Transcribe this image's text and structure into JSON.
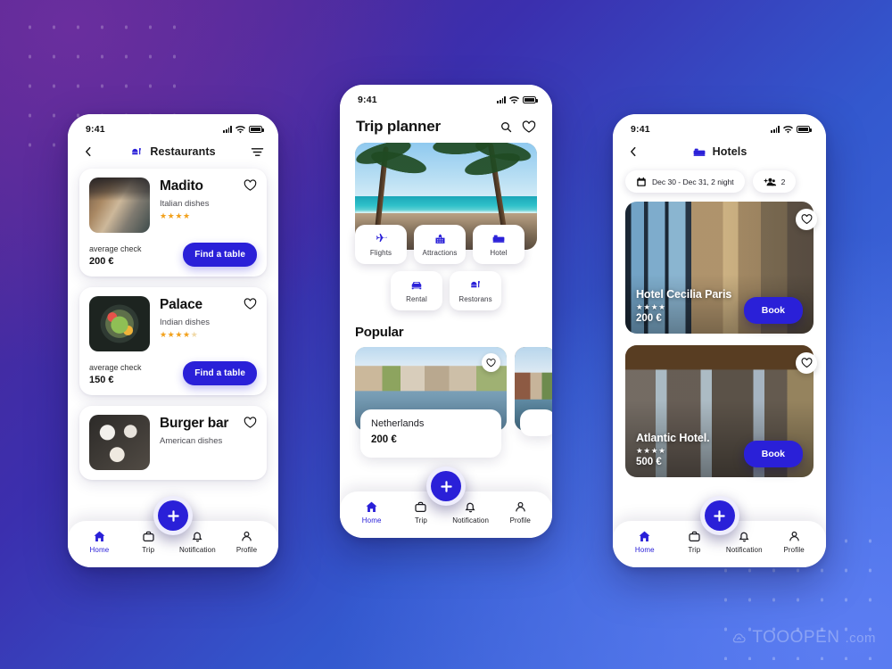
{
  "background": {
    "gradient_from": "#53268E",
    "gradient_mid": "#3358CE",
    "gradient_to": "#4571E4",
    "accent": "#2A20D8",
    "star_color": "#F2A11C"
  },
  "watermark": {
    "brand": "TOOOPEN",
    "suffix": ".com",
    "icon": "cloud-icon"
  },
  "phones": {
    "restaurants": {
      "status": {
        "time": "9:41",
        "signal_icon": "signal-bars-icon",
        "wifi_icon": "wifi-icon",
        "battery_icon": "battery-icon"
      },
      "header": {
        "back_icon": "chevron-left-icon",
        "title_icon": "restaurant-icon",
        "title": "Restaurants",
        "filter_icon": "filter-icon"
      },
      "cards": [
        {
          "name": "Madito",
          "cuisine": "Italian dishes",
          "rating": 4,
          "rating_max": 4,
          "avg_label": "average check",
          "price": "200  €",
          "cta": "Find a table",
          "heart_icon": "heart-outline-icon",
          "thumb": "restaurant-interior-photo"
        },
        {
          "name": "Palace",
          "cuisine": "Indian dishes",
          "rating": 4,
          "rating_max": 5,
          "avg_label": "average check",
          "price": "150  €",
          "cta": "Find a table",
          "heart_icon": "heart-outline-icon",
          "thumb": "salad-bowl-photo"
        },
        {
          "name": "Burger bar",
          "cuisine": "American dishes",
          "rating": 0,
          "rating_max": 0,
          "avg_label": "",
          "price": "",
          "cta": "",
          "heart_icon": "heart-outline-icon",
          "thumb": "burger-table-photo"
        }
      ],
      "fab": {
        "icon": "plus-icon"
      },
      "nav": [
        {
          "label": "Home",
          "icon": "home-icon",
          "active": true
        },
        {
          "label": "Trip",
          "icon": "briefcase-icon",
          "active": false
        },
        {
          "label": "Notification",
          "icon": "bell-icon",
          "active": false
        },
        {
          "label": "Profile",
          "icon": "person-icon",
          "active": false
        }
      ]
    },
    "trip": {
      "status": {
        "time": "9:41",
        "signal_icon": "signal-bars-icon",
        "wifi_icon": "wifi-icon",
        "battery_icon": "battery-icon"
      },
      "header": {
        "title": "Trip planner",
        "search_icon": "search-icon",
        "favorite_icon": "heart-outline-icon"
      },
      "hero": {
        "image": "tropical-beach-palms-photo"
      },
      "categories": [
        {
          "label": "Flights",
          "icon": "airplane-icon"
        },
        {
          "label": "Attractions",
          "icon": "building-icon"
        },
        {
          "label": "Hotel",
          "icon": "bed-icon"
        },
        {
          "label": "Rental",
          "icon": "car-icon"
        },
        {
          "label": "Restorans",
          "icon": "restaurant-icon"
        }
      ],
      "popular": {
        "title": "Popular",
        "items": [
          {
            "name": "Netherlands",
            "price": "200  €",
            "heart_icon": "heart-outline-icon",
            "image": "amsterdam-canal-photo"
          },
          {
            "name": "",
            "price": "",
            "heart_icon": "",
            "image": "dutch-houses-photo"
          }
        ]
      },
      "fab": {
        "icon": "plus-icon"
      },
      "nav": [
        {
          "label": "Home",
          "icon": "home-icon",
          "active": true
        },
        {
          "label": "Trip",
          "icon": "briefcase-icon",
          "active": false
        },
        {
          "label": "Notification",
          "icon": "bell-icon",
          "active": false
        },
        {
          "label": "Profile",
          "icon": "person-icon",
          "active": false
        }
      ]
    },
    "hotels": {
      "status": {
        "time": "9:41",
        "signal_icon": "signal-bars-icon",
        "wifi_icon": "wifi-icon",
        "battery_icon": "battery-icon"
      },
      "header": {
        "back_icon": "chevron-left-icon",
        "title_icon": "bed-icon",
        "title": "Hotels"
      },
      "filters": [
        {
          "icon": "calendar-icon",
          "text": "Dec 30 - Dec 31, 2 night"
        },
        {
          "icon": "add-people-icon",
          "text": "2"
        }
      ],
      "cards": [
        {
          "name": "Hotel Cecilia Paris",
          "rating": 4,
          "price": "200  €",
          "cta": "Book",
          "heart_icon": "heart-outline-icon",
          "image": "hotel-room-window-city-photo"
        },
        {
          "name": "Atlantic Hotel.",
          "rating": 4,
          "price": "500  €",
          "cta": "Book",
          "heart_icon": "heart-outline-icon",
          "image": "rustic-stone-room-photo"
        }
      ],
      "fab": {
        "icon": "plus-icon"
      },
      "nav": [
        {
          "label": "Home",
          "icon": "home-icon",
          "active": true
        },
        {
          "label": "Trip",
          "icon": "briefcase-icon",
          "active": false
        },
        {
          "label": "Notification",
          "icon": "bell-icon",
          "active": false
        },
        {
          "label": "Profile",
          "icon": "person-icon",
          "active": false
        }
      ]
    }
  }
}
